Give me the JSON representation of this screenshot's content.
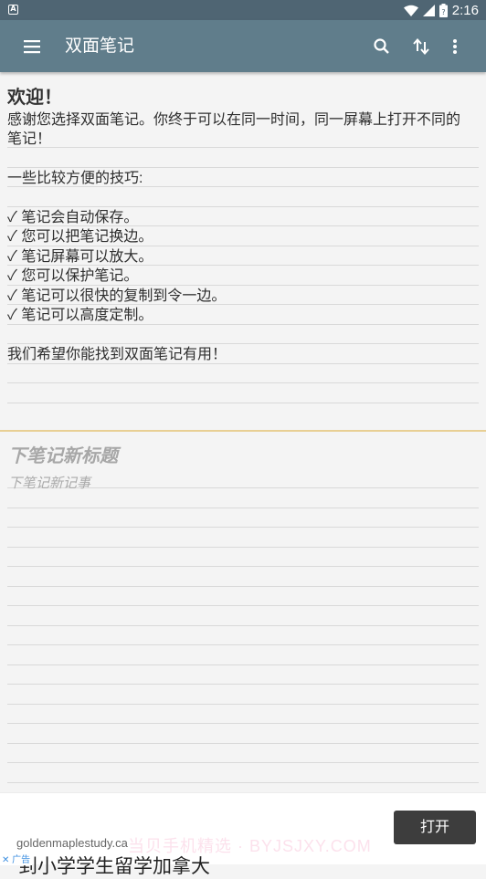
{
  "status_bar": {
    "time": "2:16"
  },
  "toolbar": {
    "title": "双面笔记",
    "icons": [
      "menu-icon",
      "search-icon",
      "swap-vertical-icon",
      "more-vert-icon"
    ]
  },
  "top_note": {
    "title": "欢迎！",
    "body": "感谢您选择双面笔记。你终于可以在同一时间，同一屏幕上打开不同的笔记！\n\n一些比较方便的技巧:\n\n✓ 笔记会自动保存。\n✓ 您可以把笔记换边。\n✓ 笔记屏幕可以放大。\n✓ 您可以保护笔记。\n✓ 笔记可以很快的复制到令一边。\n✓ 笔记可以高度定制。\n\n我们希望你能找到双面笔记有用！"
  },
  "bottom_note": {
    "title_placeholder": "下笔记新标题",
    "body_placeholder": "下笔记新记事"
  },
  "ad": {
    "domain": "goldenmaplestudy.ca",
    "button": "打开",
    "headline": "到小学学生留学加拿大",
    "tag": "✕ 广告",
    "watermark": "当贝手机精选 · BYJSJXY.COM"
  },
  "colors": {
    "toolbar": "#607d8b",
    "status_bar": "#4f6573",
    "divider": "#e8cf94",
    "background": "#f4f4f4"
  }
}
